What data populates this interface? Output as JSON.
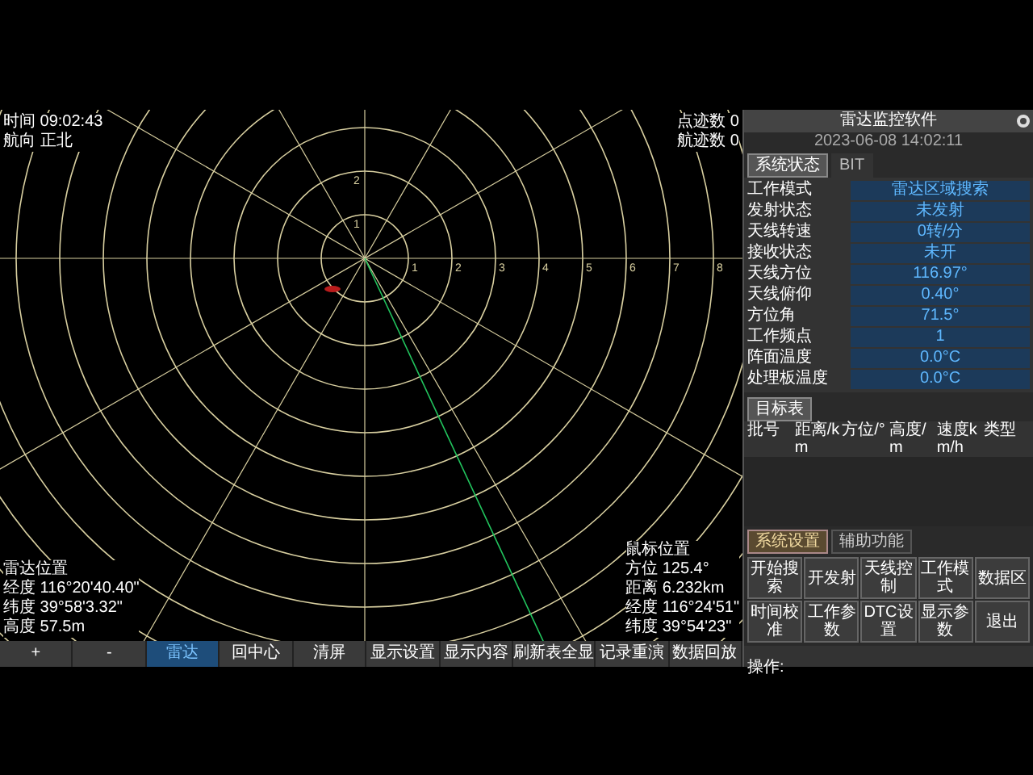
{
  "radar": {
    "top_left": [
      "时间 09:02:43",
      "航向 正北"
    ],
    "top_right": [
      "点迹数 0",
      "航迹数 0"
    ],
    "ring_labels": [
      "1",
      "2",
      "3",
      "4",
      "5",
      "6",
      "7",
      "8"
    ],
    "vertical_labels": [
      "2",
      "1"
    ],
    "radar_position": [
      "雷达位置",
      "经度 116°20'40.40\"",
      "纬度 39°58'3.32\"",
      "高度 57.5m"
    ],
    "cursor_position": [
      "鼠标位置",
      "方位 125.4°",
      "距离 6.232km",
      "经度 116°24'51\"",
      "纬度 39°54'23\""
    ]
  },
  "toolbar": [
    {
      "label": "+",
      "selected": false
    },
    {
      "label": "-",
      "selected": false
    },
    {
      "label": "雷达",
      "selected": true
    },
    {
      "label": "回中心",
      "selected": false
    },
    {
      "label": "清屏",
      "selected": false
    },
    {
      "label": "显示设置",
      "selected": false
    },
    {
      "label": "显示内容",
      "selected": false
    },
    {
      "label": "刷新表全显",
      "selected": false
    },
    {
      "label": "记录重演",
      "selected": false
    },
    {
      "label": "数据回放",
      "selected": false
    }
  ],
  "panel": {
    "title": "雷达监控软件",
    "datetime": "2023-06-08 14:02:11",
    "tabs": [
      {
        "label": "系统状态",
        "selected": true
      },
      {
        "label": "BIT",
        "selected": false
      }
    ],
    "status": [
      {
        "label": "工作模式",
        "value": "雷达区域搜索"
      },
      {
        "label": "发射状态",
        "value": "未发射"
      },
      {
        "label": "天线转速",
        "value": "0转/分"
      },
      {
        "label": "接收状态",
        "value": "未开"
      },
      {
        "label": "天线方位",
        "value": "116.97°"
      },
      {
        "label": "天线俯仰",
        "value": "0.40°"
      },
      {
        "label": "方位角",
        "value": "71.5°"
      },
      {
        "label": "工作频点",
        "value": "1"
      },
      {
        "label": "阵面温度",
        "value": "0.0°C"
      },
      {
        "label": "处理板温度",
        "value": "0.0°C"
      }
    ],
    "target_table": {
      "title": "目标表",
      "columns": [
        "批号",
        "距离/km",
        "方位/°",
        "高度/m",
        "速度km/h",
        "类型"
      ]
    },
    "bottom_tabs": [
      {
        "label": "系统设置",
        "selected": true
      },
      {
        "label": "辅助功能",
        "selected": false
      }
    ],
    "buttons": [
      "开始搜索",
      "开发射",
      "天线控制",
      "工作模式",
      "数据区",
      "时间校准",
      "工作参数",
      "DTC设置",
      "显示参数",
      "退出"
    ],
    "status_line": "操作:"
  }
}
